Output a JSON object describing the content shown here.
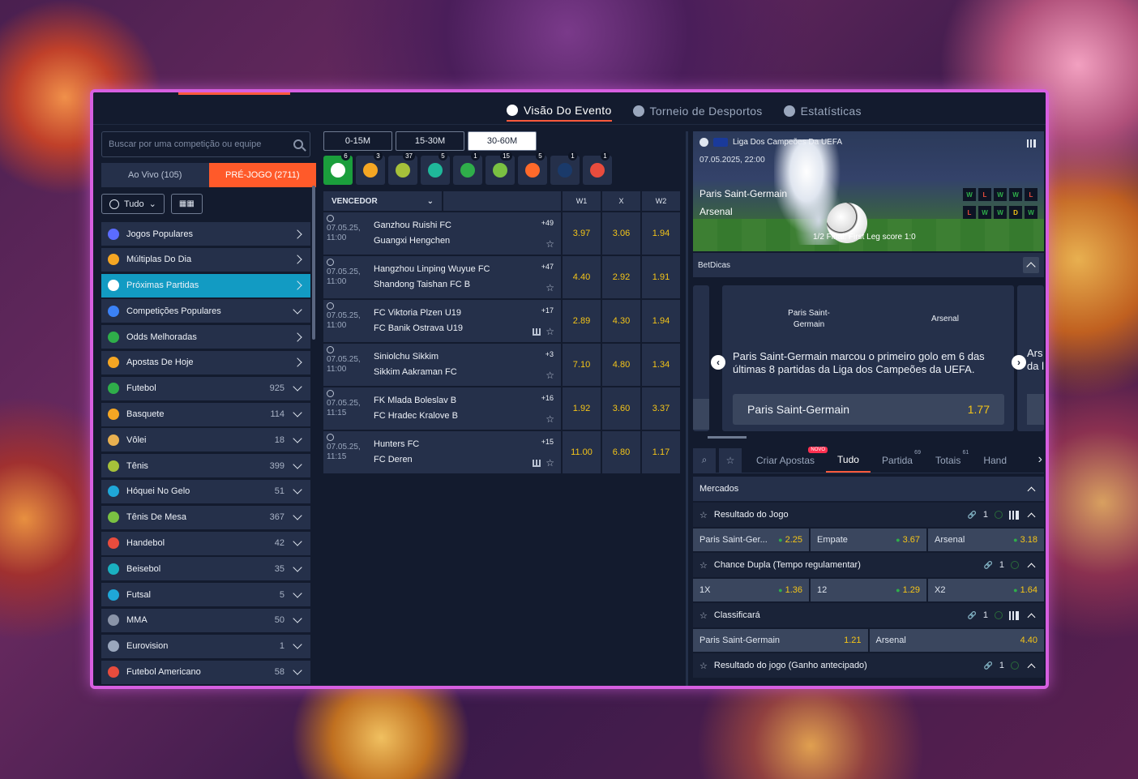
{
  "tabs": [
    {
      "label": "Visão Do Evento",
      "active": true
    },
    {
      "label": "Torneio de Desportos"
    },
    {
      "label": "Estatísticas"
    }
  ],
  "left": {
    "search_placeholder": "Buscar por uma competição ou equipe",
    "live_label": "Ao Vivo (105)",
    "pre_label": "PRÉ-JOGO (2711)",
    "filter_label": "Tudo",
    "sports": [
      {
        "label": "Jogos Populares",
        "count": "",
        "color": "#5b6cff"
      },
      {
        "label": "Múltiplas Do Dia",
        "count": "",
        "color": "#f5a623"
      },
      {
        "label": "Próximas Partidas",
        "count": "",
        "color": "#ffffff",
        "active": true
      },
      {
        "label": "Competições Populares",
        "count": "",
        "color": "#3b82f6"
      },
      {
        "label": "Odds Melhoradas",
        "count": "",
        "color": "#2fae4a"
      },
      {
        "label": "Apostas De Hoje",
        "count": "",
        "color": "#f5a623"
      },
      {
        "label": "Futebol",
        "count": "925",
        "color": "#2fae4a"
      },
      {
        "label": "Basquete",
        "count": "114",
        "color": "#f5a623"
      },
      {
        "label": "Vôlei",
        "count": "18",
        "color": "#e8b050"
      },
      {
        "label": "Tênis",
        "count": "399",
        "color": "#a6c13a"
      },
      {
        "label": "Hóquei No Gelo",
        "count": "51",
        "color": "#1fa7d8"
      },
      {
        "label": "Tênis De Mesa",
        "count": "367",
        "color": "#7ac142"
      },
      {
        "label": "Handebol",
        "count": "42",
        "color": "#e84c3d"
      },
      {
        "label": "Beisebol",
        "count": "35",
        "color": "#1ab0c0"
      },
      {
        "label": "Futsal",
        "count": "5",
        "color": "#1fa7d8"
      },
      {
        "label": "MMA",
        "count": "50",
        "color": "#8a94a8"
      },
      {
        "label": "Eurovision",
        "count": "1",
        "color": "#9aa7bd"
      },
      {
        "label": "Futebol Americano",
        "count": "58",
        "color": "#e84c3d"
      }
    ]
  },
  "mid": {
    "time_buttons": [
      "0-15M",
      "15-30M",
      "30-60M"
    ],
    "sport_icons": [
      {
        "name": "soccer-icon",
        "count": "6",
        "color": "#ffffff"
      },
      {
        "name": "basketball-icon",
        "count": "3",
        "color": "#f5a623"
      },
      {
        "name": "tennis-icon",
        "count": "37",
        "color": "#a6c13a"
      },
      {
        "name": "badminton-icon",
        "count": "5",
        "color": "#1fb89a"
      },
      {
        "name": "cricket-icon",
        "count": "1",
        "color": "#2fae4a"
      },
      {
        "name": "table-tennis-icon",
        "count": "15",
        "color": "#7ac142"
      },
      {
        "name": "athletics-icon",
        "count": "5",
        "color": "#ff6a2a"
      },
      {
        "name": "globe-icon",
        "count": "1",
        "color": "#1a3a6a"
      },
      {
        "name": "valorant-icon",
        "count": "1",
        "color": "#e84c3d"
      }
    ],
    "header": {
      "market": "VENCEDOR",
      "c1": "W1",
      "c2": "X",
      "c3": "W2"
    },
    "matches": [
      {
        "date": "07.05.25,",
        "time": "11:00",
        "home": "Ganzhou Ruishi FC",
        "away": "Guangxi Hengchen",
        "plus": "+49",
        "w1": "3.97",
        "x": "3.06",
        "w2": "1.94",
        "stats": false
      },
      {
        "date": "07.05.25,",
        "time": "11:00",
        "home": "Hangzhou Linping Wuyue FC",
        "away": "Shandong Taishan FC B",
        "plus": "+47",
        "w1": "4.40",
        "x": "2.92",
        "w2": "1.91",
        "stats": false
      },
      {
        "date": "07.05.25,",
        "time": "11:00",
        "home": "FC Viktoria Plzen U19",
        "away": "FC Banik Ostrava U19",
        "plus": "+17",
        "w1": "2.89",
        "x": "4.30",
        "w2": "1.94",
        "stats": true
      },
      {
        "date": "07.05.25,",
        "time": "11:00",
        "home": "Siniolchu Sikkim",
        "away": "Sikkim Aakraman FC",
        "plus": "+3",
        "w1": "7.10",
        "x": "4.80",
        "w2": "1.34",
        "stats": false
      },
      {
        "date": "07.05.25,",
        "time": "11:15",
        "home": "FK Mlada Boleslav B",
        "away": "FC Hradec Kralove B",
        "plus": "+16",
        "w1": "1.92",
        "x": "3.60",
        "w2": "3.37",
        "stats": false
      },
      {
        "date": "07.05.25,",
        "time": "11:15",
        "home": "Hunters FC",
        "away": "FC Deren",
        "plus": "+15",
        "w1": "11.00",
        "x": "6.80",
        "w2": "1.17",
        "stats": true
      }
    ]
  },
  "right": {
    "league": "Liga Dos Campeões Da UEFA",
    "date": "07.05.2025, 22:00",
    "home": "Paris Saint-Germain",
    "away": "Arsenal",
    "home_form": [
      "W",
      "L",
      "W",
      "W",
      "L"
    ],
    "away_form": [
      "L",
      "W",
      "W",
      "D",
      "W"
    ],
    "result_text": "1/2 Final. First Leg score 1:0",
    "betdicas_label": "BetDicas",
    "card": {
      "home": "Paris Saint-Germain",
      "away": "Arsenal",
      "message": "Paris Saint-Germain marcou o primeiro golo em 6 das últimas 8 partidas da Liga dos Campeões da UEFA.",
      "pick": "Paris Saint-Germain",
      "odd": "1.77",
      "next_peek": "Ars",
      "next_peek2": "da l"
    },
    "market_tabs": [
      {
        "label": "Criar Apostas",
        "badge": "NOVO"
      },
      {
        "label": "Tudo",
        "active": true
      },
      {
        "label": "Partida",
        "sup": "69"
      },
      {
        "label": "Totais",
        "sup": "61"
      },
      {
        "label": "Hand"
      }
    ],
    "mercados_label": "Mercados",
    "markets": [
      {
        "title": "Resultado do Jogo",
        "links": "1",
        "stats": true,
        "odds": [
          {
            "label": "Paris Saint-Ger...",
            "value": "2.25",
            "up": true
          },
          {
            "label": "Empate",
            "value": "3.67",
            "up": true
          },
          {
            "label": "Arsenal",
            "value": "3.18",
            "up": true
          }
        ]
      },
      {
        "title": "Chance Dupla (Tempo regulamentar)",
        "links": "1",
        "stats": false,
        "odds": [
          {
            "label": "1X",
            "value": "1.36",
            "up": true
          },
          {
            "label": "12",
            "value": "1.29",
            "up": true
          },
          {
            "label": "X2",
            "value": "1.64",
            "up": true
          }
        ]
      },
      {
        "title": "Classificará",
        "links": "1",
        "stats": true,
        "odds": [
          {
            "label": "Paris Saint-Germain",
            "value": "1.21",
            "up": false
          },
          {
            "label": "Arsenal",
            "value": "4.40",
            "up": false
          }
        ]
      },
      {
        "title": "Resultado do jogo (Ganho antecipado)",
        "links": "1",
        "stats": false,
        "info": true,
        "odds": []
      }
    ]
  }
}
